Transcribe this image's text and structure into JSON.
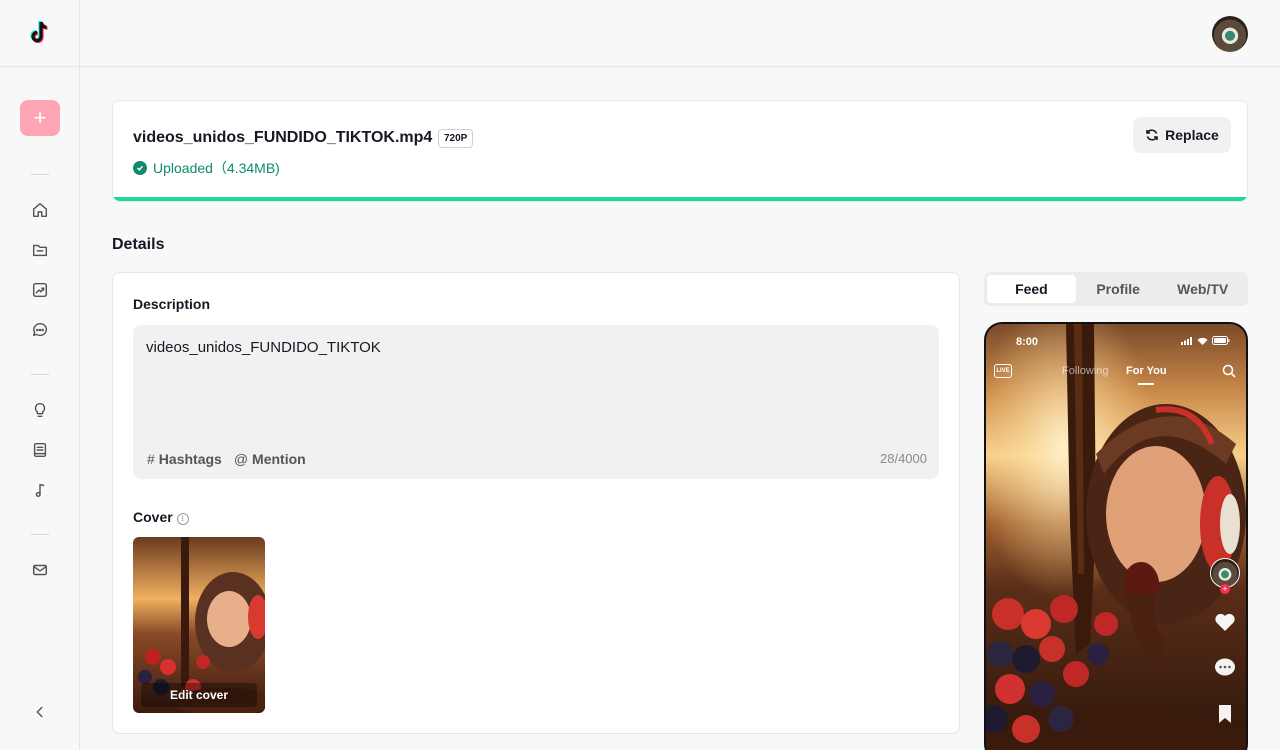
{
  "sidebar": {
    "create_label": "+",
    "nav": [
      "home-icon",
      "folder-icon",
      "analytics-icon",
      "comment-icon",
      "lightbulb-icon",
      "book-icon",
      "music-icon",
      "mail-icon"
    ],
    "collapse_label": "‹"
  },
  "upload": {
    "file_name": "videos_unidos_FUNDIDO_TIKTOK.mp4",
    "resolution": "720P",
    "status": "Uploaded（4.34MB)",
    "replace_label": "Replace",
    "progress": 1.0
  },
  "details": {
    "title": "Details",
    "description_label": "Description",
    "description_value": "videos_unidos_FUNDIDO_TIKTOK",
    "hashtags_label": "Hashtags",
    "mention_label": "Mention",
    "char_count": "28/4000",
    "cover_label": "Cover",
    "edit_cover_label": "Edit cover"
  },
  "preview": {
    "tabs": [
      "Feed",
      "Profile",
      "Web/TV"
    ],
    "active_tab": "Feed",
    "phone": {
      "time": "8:00",
      "live": "LIVE",
      "following": "Following",
      "for_you": "For You"
    }
  },
  "colors": {
    "accent_green": "#20d5a0",
    "status_green": "#0f8a6c",
    "create_pink": "#fda4b5"
  }
}
